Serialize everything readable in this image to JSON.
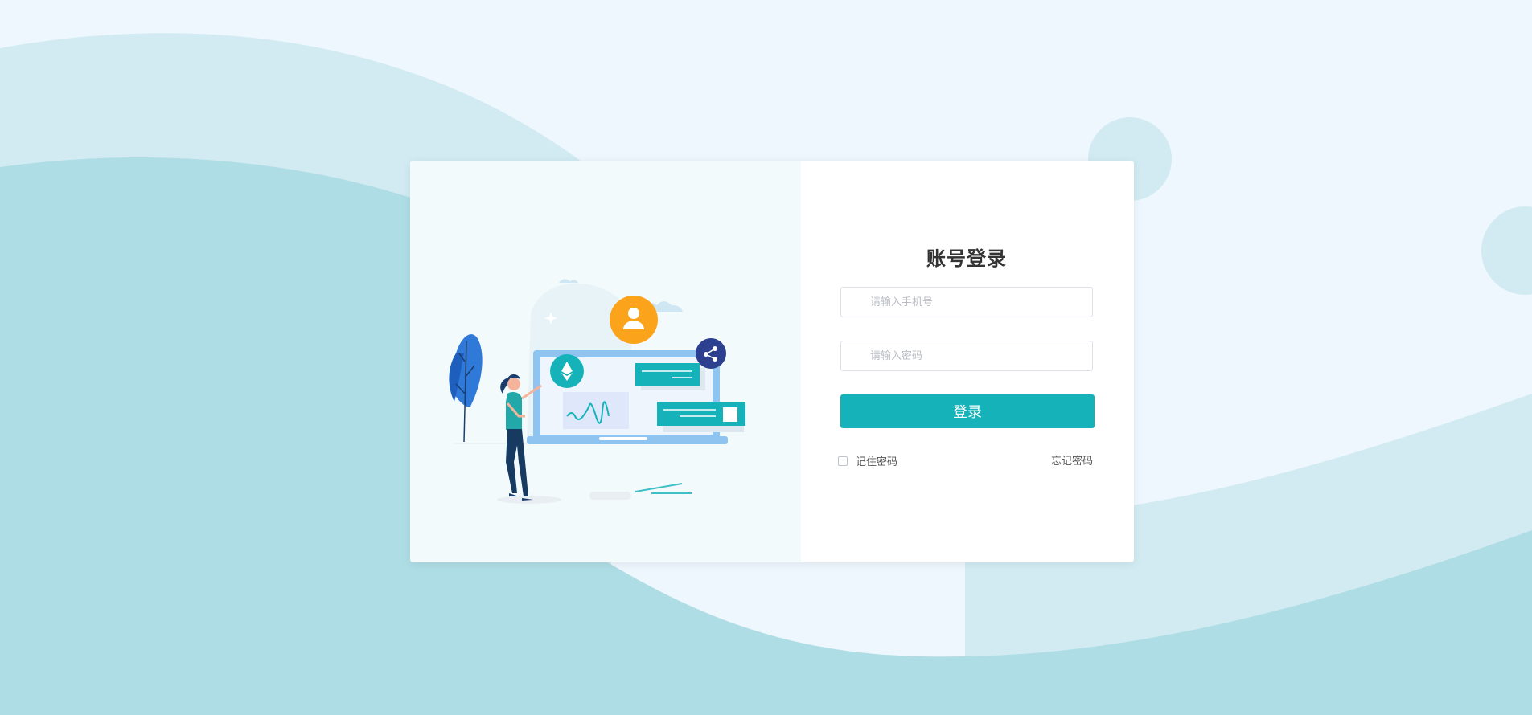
{
  "login": {
    "title": "账号登录",
    "phone_placeholder": "请输入手机号",
    "password_placeholder": "请输入密码",
    "submit_label": "登录",
    "remember_label": "记住密码",
    "forgot_label": "忘记密码"
  },
  "colors": {
    "primary": "#15b3b9",
    "background": "#eef7fd",
    "wave_light": "#d2ebf2",
    "wave_dark": "#afdde5",
    "accent_orange": "#fba41b",
    "accent_navy": "#2d3f8f"
  }
}
